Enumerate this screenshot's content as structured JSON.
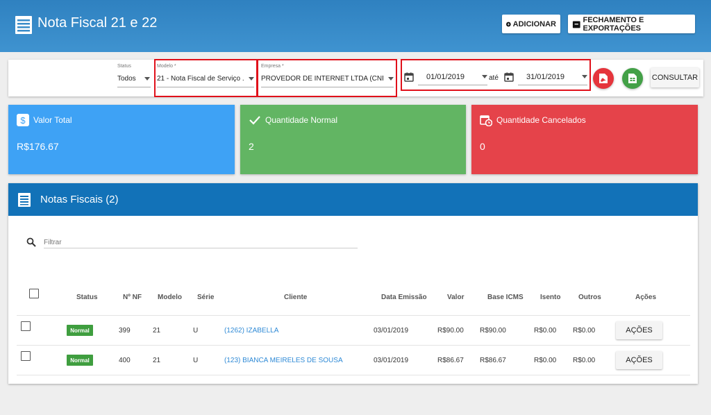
{
  "header": {
    "title": "Nota Fiscal 21 e 22",
    "add_label": "ADICIONAR",
    "export_label": "FECHAMENTO E EXPORTAÇÕES"
  },
  "filters": {
    "status_label": "Status",
    "status_value": "Todos",
    "modelo_label": "Modelo *",
    "modelo_value": "21 - Nota Fiscal de Serviço ...",
    "empresa_label": "Empresa *",
    "empresa_value": "PROVEDOR DE INTERNET LTDA (CNPJ: ...",
    "date_from": "01/01/2019",
    "date_sep": "até",
    "date_to": "31/01/2019",
    "consultar_label": "CONSULTAR"
  },
  "cards": {
    "total_title": "Valor Total",
    "total_value": "R$176.67",
    "normal_title": "Quantidade Normal",
    "normal_value": "2",
    "cancel_title": "Quantidade Cancelados",
    "cancel_value": "0"
  },
  "panel": {
    "title": "Notas Fiscais (2)",
    "search_placeholder": "Filtrar"
  },
  "table": {
    "headers": [
      "Status",
      "Nº NF",
      "Modelo",
      "Série",
      "Cliente",
      "Data Emissão",
      "Valor",
      "Base ICMS",
      "Isento",
      "Outros",
      "Ações"
    ],
    "rows": [
      {
        "status": "Normal",
        "nf": "399",
        "modelo": "21",
        "serie": "U",
        "cliente": "(1262) IZABELLA",
        "data": "03/01/2019",
        "valor": "R$90.00",
        "base": "R$90.00",
        "isento": "R$0.00",
        "outros": "R$0.00",
        "acoes": "AÇÕES"
      },
      {
        "status": "Normal",
        "nf": "400",
        "modelo": "21",
        "serie": "U",
        "cliente": "(123) BIANCA MEIRELES DE SOUSA",
        "data": "03/01/2019",
        "valor": "R$86.67",
        "base": "R$86.67",
        "isento": "R$0.00",
        "outros": "R$0.00",
        "acoes": "AÇÕES"
      }
    ]
  },
  "colors": {
    "header": "#3a8cc9",
    "panel_head": "#1272b8",
    "card_blue": "#3ea2f5",
    "card_green": "#62b563",
    "card_red": "#e5434a",
    "highlight": "#e0101a"
  },
  "icons": [
    "menu-icon",
    "add-circle-icon",
    "archive-icon",
    "calendar-icon",
    "pdf-icon",
    "spreadsheet-icon",
    "dollar-icon",
    "check-icon",
    "calendar-clock-icon",
    "list-icon",
    "search-icon",
    "chevron-down-icon"
  ]
}
